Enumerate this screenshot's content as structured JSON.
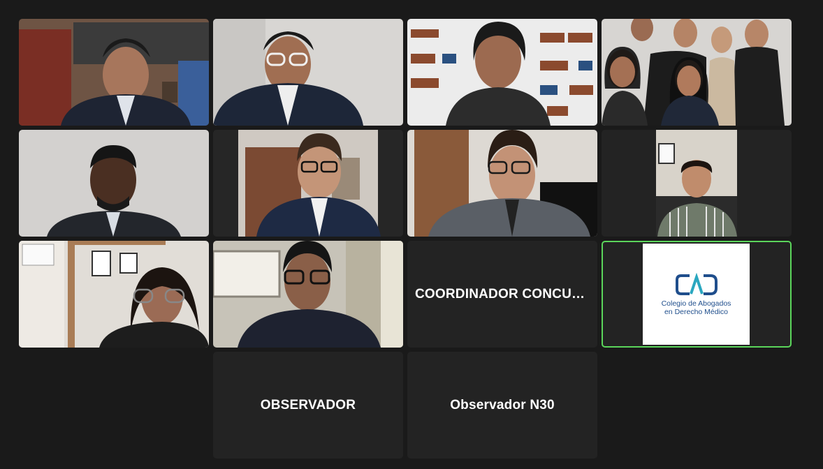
{
  "participants": [
    {
      "type": "video"
    },
    {
      "type": "video"
    },
    {
      "type": "video"
    },
    {
      "type": "video"
    },
    {
      "type": "video"
    },
    {
      "type": "video"
    },
    {
      "type": "video"
    },
    {
      "type": "video"
    },
    {
      "type": "video"
    },
    {
      "type": "video"
    },
    {
      "type": "name",
      "label": "COORDINADOR CONCUR..."
    },
    {
      "type": "logo",
      "logo_lines": [
        "Colegio de Abogados",
        "en Derecho Médico"
      ],
      "active": true
    },
    {
      "type": "name",
      "label": "OBSERVADOR"
    },
    {
      "type": "name",
      "label": "Observador N30"
    }
  ],
  "colors": {
    "background": "#1a1a1a",
    "tile": "#232323",
    "active_speaker": "#5bd55b",
    "logo_blue": "#1f4e8c",
    "logo_teal": "#2aa7c0"
  }
}
